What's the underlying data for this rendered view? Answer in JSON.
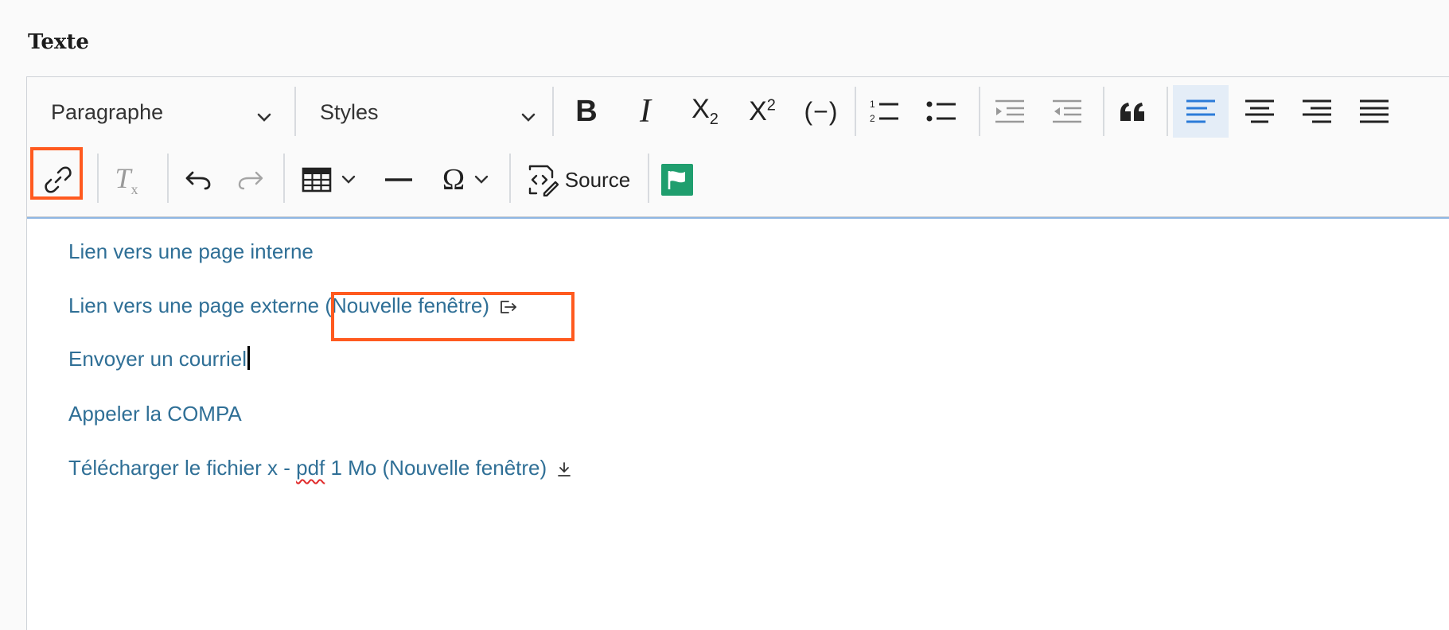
{
  "field": {
    "label": "Texte"
  },
  "toolbar": {
    "format_select": "Paragraphe",
    "styles_select": "Styles",
    "bold": "B",
    "italic": "I",
    "subscript_base": "X",
    "subscript_mark": "2",
    "superscript_base": "X",
    "superscript_mark": "2",
    "code": "(−)",
    "source_label": "Source",
    "remove_format_base": "T",
    "remove_format_mark": "x",
    "special_char": "Ω",
    "quote": "❝",
    "icons": [
      "bold-icon",
      "italic-icon",
      "subscript-icon",
      "superscript-icon",
      "code-icon",
      "numbered-list-icon",
      "bulleted-list-icon",
      "outdent-icon",
      "indent-icon",
      "blockquote-icon",
      "align-left-icon",
      "align-center-icon",
      "align-right-icon",
      "justify-icon",
      "link-icon",
      "remove-format-icon",
      "undo-icon",
      "redo-icon",
      "table-icon",
      "horizontal-line-icon",
      "special-character-icon",
      "source-icon",
      "flag-icon"
    ],
    "active_alignment": "left"
  },
  "content": {
    "line1": "Lien vers une page interne",
    "line2_a": "Lien vers une page extern",
    "line2_b": "e (Nouvelle fenêtre)",
    "line3": "Envoyer un courriel",
    "line4": "Appeler la COMPA",
    "line5_a": "Télécharger le fichier x - ",
    "line5_b": "pdf",
    "line5_c": " 1 Mo (Nouvelle fenêtre)"
  },
  "colors": {
    "link": "#2f6f96",
    "highlight": "#ff5a1f",
    "flag": "#1f9e6e",
    "active": "#2b7bd8"
  }
}
